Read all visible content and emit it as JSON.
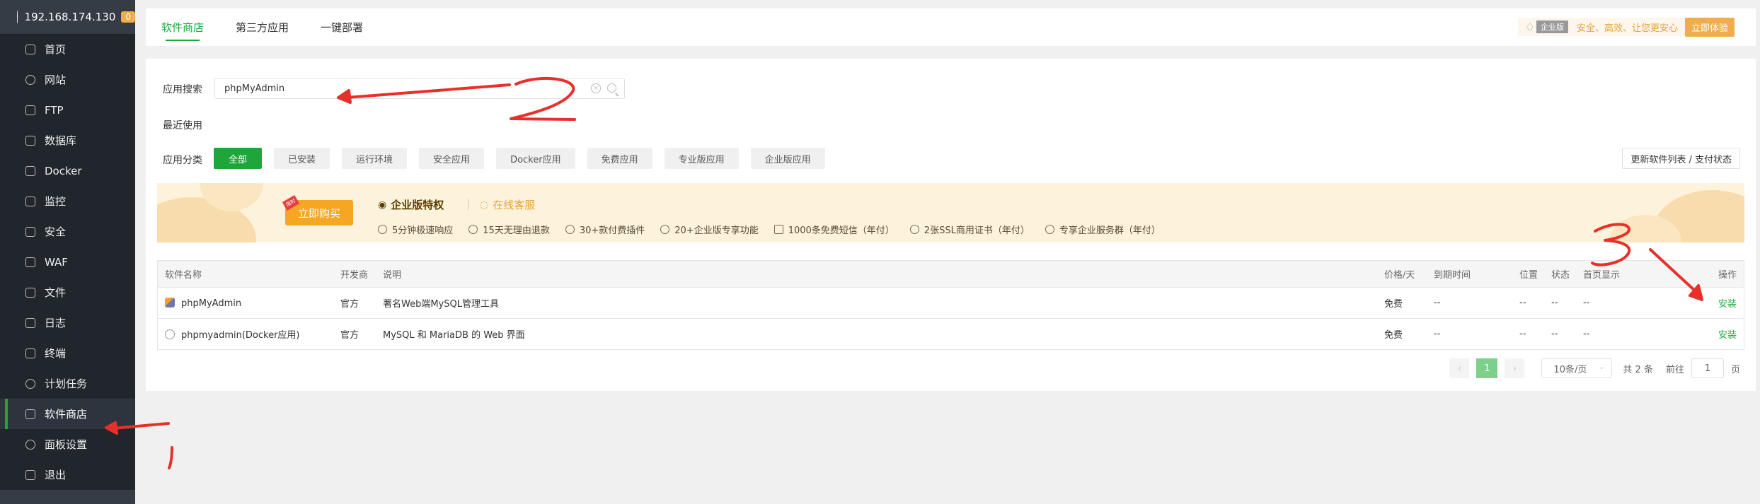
{
  "sidebar": {
    "ip": "192.168.174.130",
    "badge": "0",
    "items": [
      {
        "label": "首页",
        "icon": "home-icon"
      },
      {
        "label": "网站",
        "icon": "globe-icon"
      },
      {
        "label": "FTP",
        "icon": "ftp-icon"
      },
      {
        "label": "数据库",
        "icon": "database-icon"
      },
      {
        "label": "Docker",
        "icon": "docker-icon"
      },
      {
        "label": "监控",
        "icon": "monitor-icon"
      },
      {
        "label": "安全",
        "icon": "shield-icon"
      },
      {
        "label": "WAF",
        "icon": "waf-icon"
      },
      {
        "label": "文件",
        "icon": "folder-icon"
      },
      {
        "label": "日志",
        "icon": "log-icon"
      },
      {
        "label": "终端",
        "icon": "terminal-icon"
      },
      {
        "label": "计划任务",
        "icon": "clock-icon"
      },
      {
        "label": "软件商店",
        "icon": "grid-icon"
      },
      {
        "label": "面板设置",
        "icon": "gear-icon"
      },
      {
        "label": "退出",
        "icon": "logout-icon"
      }
    ]
  },
  "header": {
    "tabs": [
      "软件商店",
      "第三方应用",
      "一键部署"
    ],
    "promo_badge": "企业版",
    "promo_text": "安全、高效、让您更安心",
    "promo_button": "立即体验"
  },
  "search": {
    "label": "应用搜索",
    "value": "phpMyAdmin"
  },
  "recent": {
    "label": "最近使用"
  },
  "categories": {
    "label": "应用分类",
    "items": [
      "全部",
      "已安装",
      "运行环境",
      "安全应用",
      "Docker应用",
      "免费应用",
      "专业版应用",
      "企业版应用"
    ],
    "refresh_button": "更新软件列表 / 支付状态"
  },
  "banner": {
    "buy_button": "立即购买",
    "ribbon": "限时",
    "title": "企业版特权",
    "service": "在线客服",
    "features": [
      "5分钟极速响应",
      "15天无理由退款",
      "30+款付费插件",
      "20+企业版专享功能",
      "1000条免费短信（年付）",
      "2张SSL商用证书（年付）",
      "专享企业服务群（年付）"
    ]
  },
  "table": {
    "headers": {
      "name": "软件名称",
      "dev": "开发商",
      "desc": "说明",
      "price": "价格/天",
      "expire": "到期时间",
      "location": "位置",
      "status": "状态",
      "home": "首页显示",
      "action": "操作"
    },
    "rows": [
      {
        "name": "phpMyAdmin",
        "dev": "官方",
        "desc": "著名Web端MySQL管理工具",
        "price": "免费",
        "expire": "--",
        "location": "--",
        "status": "--",
        "home": "--",
        "action": "安装"
      },
      {
        "name": "phpmyadmin(Docker应用)",
        "dev": "官方",
        "desc": "MySQL 和 MariaDB 的 Web 界面",
        "price": "免费",
        "expire": "--",
        "location": "--",
        "status": "--",
        "home": "--",
        "action": "安装"
      }
    ]
  },
  "pagination": {
    "current": "1",
    "page_size": "10条/页",
    "total": "共 2 条",
    "goto_label": "前往",
    "goto_value": "1",
    "page_suffix": "页"
  },
  "colors": {
    "accent": "#20a53a",
    "sidebar": "#363c45",
    "annotation": "#e8302a"
  }
}
